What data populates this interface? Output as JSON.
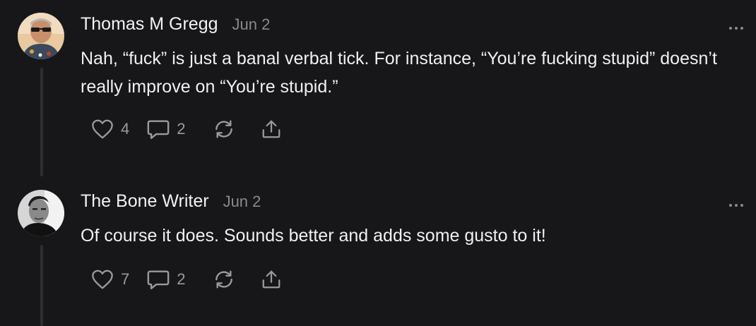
{
  "comments": [
    {
      "author": "Thomas M Gregg",
      "date": "Jun 2",
      "text": "Nah, “fuck” is just a banal verbal tick. For instance, “You’re fucking stupid” doesn’t really improve on “You’re stupid.”",
      "likes": "4",
      "replies": "2",
      "avatar_bg": "#d9b98a"
    },
    {
      "author": "The Bone Writer",
      "date": "Jun 2",
      "text": "Of course it does. Sounds better and adds some gusto to it!",
      "likes": "7",
      "replies": "2",
      "avatar_bg": "#cfcfcf"
    }
  ],
  "icons": {
    "like": "heart-icon",
    "reply": "speech-bubble-icon",
    "restack": "restack-icon",
    "share": "share-icon",
    "more": "ellipsis-icon"
  },
  "colors": {
    "background": "#17171a",
    "text": "#f2f2f2",
    "muted": "#8a8a8e",
    "thread_line": "#2e2e31"
  }
}
